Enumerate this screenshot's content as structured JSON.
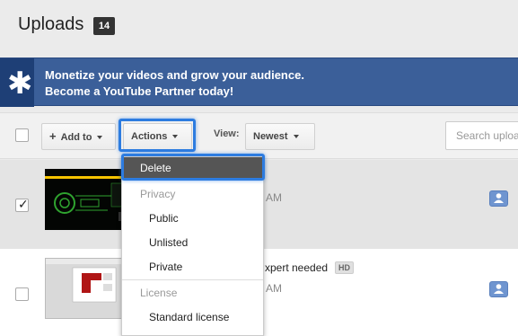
{
  "header": {
    "title": "Uploads",
    "count": "14"
  },
  "banner": {
    "line1": "Monetize your videos and grow your audience.",
    "line2": "Become a YouTube Partner today!",
    "icon": "asterisk-icon"
  },
  "toolbar": {
    "add_to_label": "Add to",
    "actions_label": "Actions",
    "view_label": "View:",
    "sort_label": "Newest",
    "search_placeholder": "Search uploads"
  },
  "videos": [
    {
      "time": "AM",
      "checked": true
    },
    {
      "title": "xpert needed",
      "hd_badge": "HD",
      "time": "AM",
      "checked": false
    }
  ],
  "actions_menu": {
    "delete": "Delete",
    "privacy_header": "Privacy",
    "privacy_options": [
      "Public",
      "Unlisted",
      "Private"
    ],
    "license_header": "License",
    "license_options": [
      "Standard license"
    ]
  },
  "colors": {
    "banner_bg": "#3b5f99",
    "banner_tab": "#1e3f76",
    "focus_ring": "#2d7ce0",
    "share_button": "#6f95d0"
  }
}
